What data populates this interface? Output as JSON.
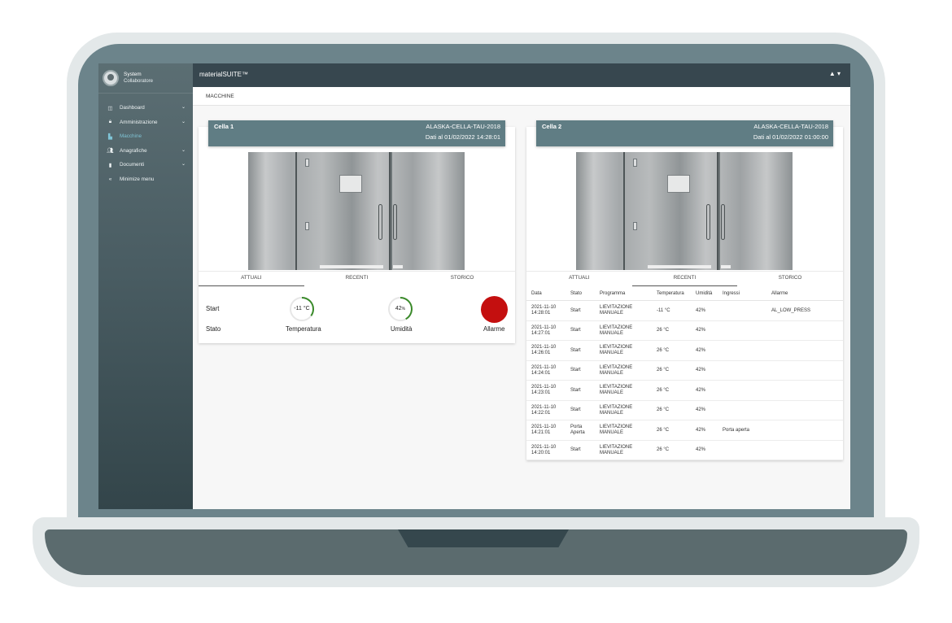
{
  "app": {
    "brand": "materialSUITE™",
    "user_menu": "▲ ▾"
  },
  "user": {
    "name": "System",
    "role": "Collaboratore"
  },
  "sidebar": {
    "items": [
      {
        "label": "Dashboard",
        "icon": "dashboard-icon",
        "glyph": "◫",
        "chevron": "⌄"
      },
      {
        "label": "Amministrazione",
        "icon": "lock-icon",
        "glyph": "🔒︎",
        "chevron": "⌄"
      },
      {
        "label": "Macchine",
        "icon": "factory-icon",
        "glyph": "▙",
        "chevron": ""
      },
      {
        "label": "Anagrafiche",
        "icon": "people-icon",
        "glyph": "👥︎",
        "chevron": "⌄"
      },
      {
        "label": "Documenti",
        "icon": "document-icon",
        "glyph": "▮",
        "chevron": "⌄"
      },
      {
        "label": "Minimize menu",
        "icon": "double-chevron-left-icon",
        "glyph": "«",
        "chevron": ""
      }
    ]
  },
  "breadcrumb": "MACCHINE",
  "colors": {
    "topbar": "#37474f",
    "card_header": "#607d84",
    "alarm": "#c40f0f",
    "gauge": "#3a8a2a"
  },
  "cards": [
    {
      "title": "Cella 1",
      "machine": "ALASKA-CELLA-TAU-2018",
      "date": "Dati al 01/02/2022 14:28:01",
      "tabs": [
        "ATTUALI",
        "RECENTI",
        "STORICO"
      ],
      "active_tab": "ATTUALI",
      "attuali": {
        "stato_value": "Start",
        "stato_label": "Stato",
        "temperature": "-11 °C",
        "temperature_label": "Temperatura",
        "temperature_fraction": 0.35,
        "humidity": "42",
        "humidity_unit": "%",
        "humidity_label": "Umidità",
        "humidity_fraction": 0.42,
        "alarm_label": "Allarme"
      }
    },
    {
      "title": "Cella 2",
      "machine": "ALASKA-CELLA-TAU-2018",
      "date": "Dati al 01/02/2022  01:00:00",
      "tabs": [
        "ATTUALI",
        "RECENTI",
        "STORICO"
      ],
      "active_tab": "RECENTI",
      "table": {
        "headers": [
          "Data",
          "Stato",
          "Programma",
          "Temperatura",
          "Umidità",
          "Ingressi",
          "Allarme"
        ],
        "rows": [
          {
            "date": "2021-11-10",
            "time": "14:28:01",
            "stato": "Start",
            "stato2": "",
            "prog": "LIEVITAZIONE",
            "prog2": "MANUALE",
            "temp": "-11 °C",
            "hum": "42%",
            "ingressi": "",
            "allarme": "AL_LOW_PRESS"
          },
          {
            "date": "2021-11-10",
            "time": "14:27:01",
            "stato": "Start",
            "stato2": "",
            "prog": "LIEVITAZIONE",
            "prog2": "MANUALE",
            "temp": "26 °C",
            "hum": "42%",
            "ingressi": "",
            "allarme": ""
          },
          {
            "date": "2021-11-10",
            "time": "14:26:01",
            "stato": "Start",
            "stato2": "",
            "prog": "LIEVITAZIONE",
            "prog2": "MANUALE",
            "temp": "26 °C",
            "hum": "42%",
            "ingressi": "",
            "allarme": ""
          },
          {
            "date": "2021-11-10",
            "time": "14:24:01",
            "stato": "Start",
            "stato2": "",
            "prog": "LIEVITAZIONE",
            "prog2": "MANUALE",
            "temp": "26 °C",
            "hum": "42%",
            "ingressi": "",
            "allarme": ""
          },
          {
            "date": "2021-11-10",
            "time": "14:23:01",
            "stato": "Start",
            "stato2": "",
            "prog": "LIEVITAZIONE",
            "prog2": "MANUALE",
            "temp": "26 °C",
            "hum": "42%",
            "ingressi": "",
            "allarme": ""
          },
          {
            "date": "2021-11-10",
            "time": "14:22:01",
            "stato": "Start",
            "stato2": "",
            "prog": "LIEVITAZIONE",
            "prog2": "MANUALE",
            "temp": "26 °C",
            "hum": "42%",
            "ingressi": "",
            "allarme": ""
          },
          {
            "date": "2021-11-10",
            "time": "14:21:01",
            "stato": "Porta",
            "stato2": "Aperta",
            "prog": "LIEVITAZIONE",
            "prog2": "MANUALE",
            "temp": "26 °C",
            "hum": "42%",
            "ingressi": "Porta aperta",
            "allarme": ""
          },
          {
            "date": "2021-11-10",
            "time": "14:20:01",
            "stato": "Start",
            "stato2": "",
            "prog": "LIEVITAZIONE",
            "prog2": "MANUALE",
            "temp": "26 °C",
            "hum": "42%",
            "ingressi": "",
            "allarme": ""
          }
        ]
      }
    }
  ]
}
